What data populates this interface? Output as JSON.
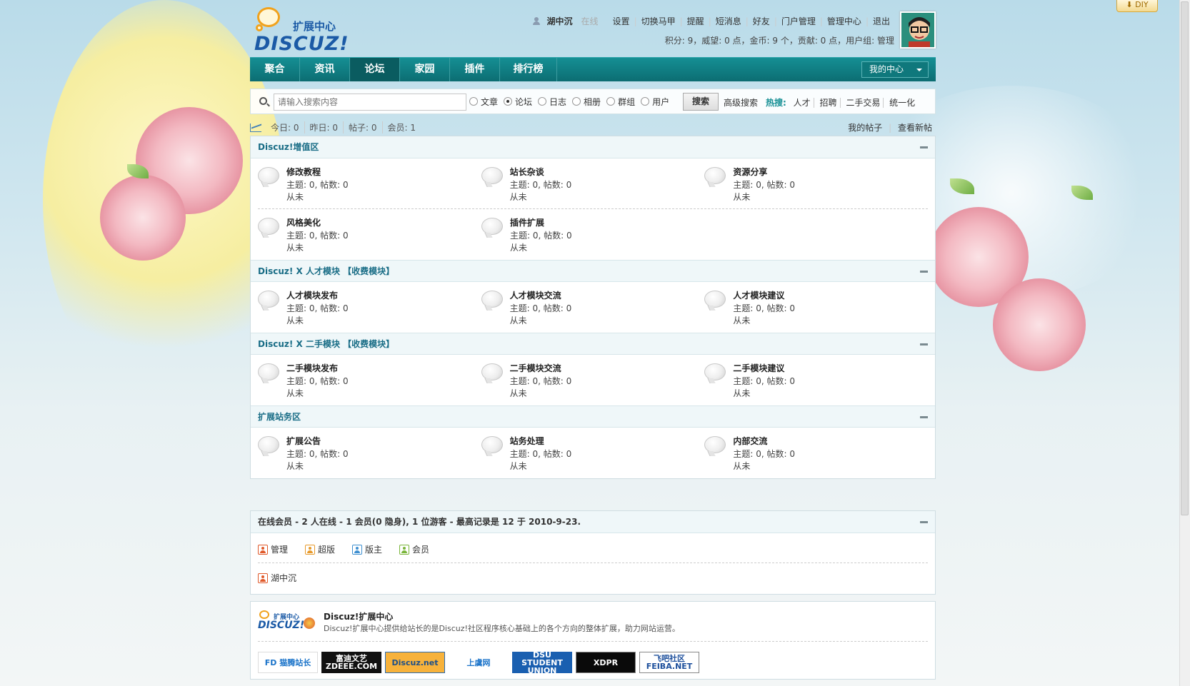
{
  "header": {
    "logo_sub": "扩展中心",
    "logo_brand": "DISCUZ!",
    "username": "湖中沉",
    "status": "在线",
    "links": [
      "设置",
      "切换马甲",
      "提醒",
      "短消息",
      "好友",
      "门户管理",
      "管理中心",
      "退出"
    ],
    "credits": "积分: 9，威望: 0 点，金币: 9 个，贡献: 0 点，用户组: 管理"
  },
  "diy": "DIY",
  "nav": {
    "items": [
      "聚合",
      "资讯",
      "论坛",
      "家园",
      "插件",
      "排行榜"
    ],
    "active": "论坛",
    "my_center": "我的中心"
  },
  "search": {
    "placeholder": "请输入搜索内容",
    "types": [
      "文章",
      "论坛",
      "日志",
      "相册",
      "群组",
      "用户"
    ],
    "selected": "论坛",
    "button": "搜索",
    "advanced": "高级搜索",
    "hot_label": "热搜:",
    "hot": [
      "人才",
      "招聘",
      "二手交易",
      "统一化"
    ]
  },
  "stats": {
    "items": [
      "今日: 0",
      "昨日: 0",
      "帖子: 0",
      "会员: 1"
    ],
    "links": [
      "我的帖子",
      "查看新帖"
    ]
  },
  "categories": [
    {
      "title": "Discuz!增值区",
      "forums": [
        {
          "name": "修改教程",
          "count": "主题: 0, 帖数: 0",
          "last": "从未"
        },
        {
          "name": "站长杂谈",
          "count": "主题: 0, 帖数: 0",
          "last": "从未"
        },
        {
          "name": "资源分享",
          "count": "主题: 0, 帖数: 0",
          "last": "从未"
        },
        {
          "name": "风格美化",
          "count": "主题: 0, 帖数: 0",
          "last": "从未"
        },
        {
          "name": "插件扩展",
          "count": "主题: 0, 帖数: 0",
          "last": "从未"
        }
      ]
    },
    {
      "title": "Discuz! X 人才模块 【收费模块】",
      "forums": [
        {
          "name": "人才模块发布",
          "count": "主题: 0, 帖数: 0",
          "last": "从未"
        },
        {
          "name": "人才模块交流",
          "count": "主题: 0, 帖数: 0",
          "last": "从未"
        },
        {
          "name": "人才模块建议",
          "count": "主题: 0, 帖数: 0",
          "last": "从未"
        }
      ]
    },
    {
      "title": "Discuz! X 二手模块 【收费模块】",
      "forums": [
        {
          "name": "二手模块发布",
          "count": "主题: 0, 帖数: 0",
          "last": "从未"
        },
        {
          "name": "二手模块交流",
          "count": "主题: 0, 帖数: 0",
          "last": "从未"
        },
        {
          "name": "二手模块建议",
          "count": "主题: 0, 帖数: 0",
          "last": "从未"
        }
      ]
    },
    {
      "title": "扩展站务区",
      "forums": [
        {
          "name": "扩展公告",
          "count": "主题: 0, 帖数: 0",
          "last": "从未"
        },
        {
          "name": "站务处理",
          "count": "主题: 0, 帖数: 0",
          "last": "从未"
        },
        {
          "name": "内部交流",
          "count": "主题: 0, 帖数: 0",
          "last": "从未"
        }
      ]
    }
  ],
  "online": {
    "title": "在线会员 - 2 人在线 - 1 会员(0 隐身), 1 位游客 - 最高记录是 12 于 2010-9-23.",
    "legend": [
      {
        "label": "管理",
        "color": "#e0592a"
      },
      {
        "label": "超版",
        "color": "#e79a2b"
      },
      {
        "label": "版主",
        "color": "#3e8fd0"
      },
      {
        "label": "会员",
        "color": "#7ab53a"
      }
    ],
    "members": [
      "湖中沉"
    ]
  },
  "footer": {
    "logo_sub": "扩展中心",
    "logo_brand": "DISCUZ!",
    "title": "Discuz!扩展中心",
    "desc": "Discuz!扩展中心提供给站长的是Discuz!社区程序核心基础上的各个方向的整体扩展，助力网站运营。",
    "friend_links": [
      {
        "text": "FD 猫腾站长",
        "bg": "#ffffff",
        "fg": "#1a73c9"
      },
      {
        "text": "富迪文艺 ZDEEE.COM",
        "bg": "#111111",
        "fg": "#ffffff"
      },
      {
        "text": "Discuz.net",
        "bg": "#f7b23b",
        "fg": "#1c4f8a"
      },
      {
        "text": "上虞网",
        "bg": "#ffffff",
        "fg": "#1a73c9"
      },
      {
        "text": "DSU STUDENT UNION",
        "bg": "#1a5fb0",
        "fg": "#ffffff"
      },
      {
        "text": "XDPR",
        "bg": "#0a0a0a",
        "fg": "#ffffff"
      },
      {
        "text": "飞吧社区 FEIBA.NET",
        "bg": "#ffffff",
        "fg": "#1d4f9c"
      }
    ]
  }
}
